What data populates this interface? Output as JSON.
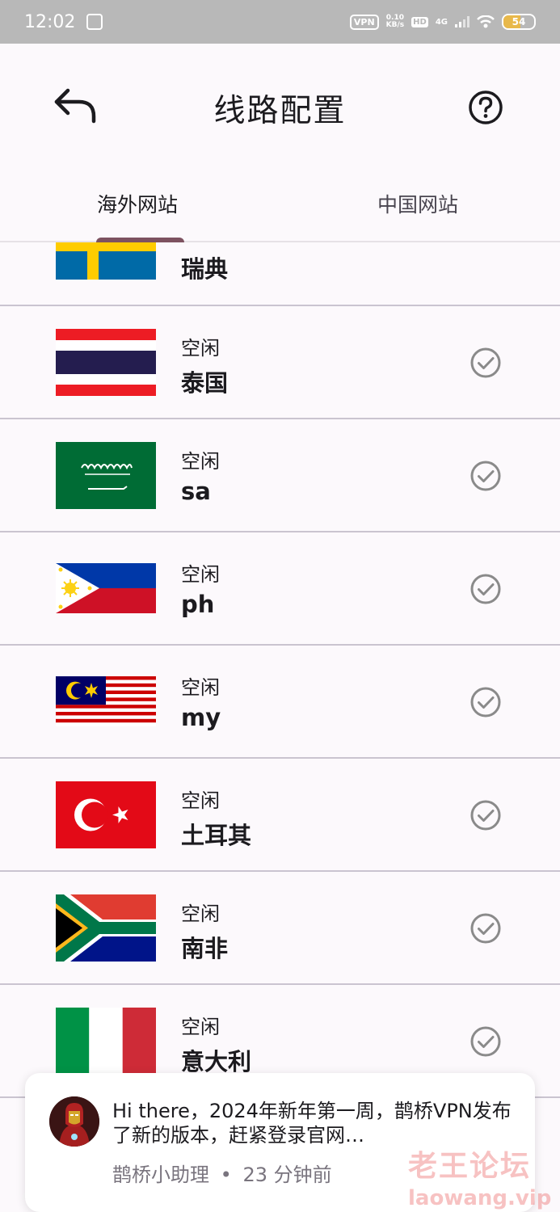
{
  "status_bar": {
    "time": "12:02",
    "vpn": "VPN",
    "speed_value": "0.10",
    "speed_unit": "KB/s",
    "hd": "HD",
    "network": "4G",
    "battery": "54",
    "battery_level": 0.54,
    "battery_color": "#e8b84a"
  },
  "header": {
    "title": "线路配置",
    "back_icon": "back-arrow-icon",
    "help_icon": "help-circle-icon"
  },
  "tabs": [
    {
      "label": "海外网站",
      "selected": true
    },
    {
      "label": "中国网站",
      "selected": false
    }
  ],
  "servers": [
    {
      "status": "",
      "name": "瑞典",
      "flag": "sweden"
    },
    {
      "status": "空闲",
      "name": "泰国",
      "flag": "thailand"
    },
    {
      "status": "空闲",
      "name": "sa",
      "flag": "saudi-arabia"
    },
    {
      "status": "空闲",
      "name": "ph",
      "flag": "philippines"
    },
    {
      "status": "空闲",
      "name": "my",
      "flag": "malaysia"
    },
    {
      "status": "空闲",
      "name": "土耳其",
      "flag": "turkey"
    },
    {
      "status": "空闲",
      "name": "南非",
      "flag": "south-africa"
    },
    {
      "status": "空闲",
      "name": "意大利",
      "flag": "italy"
    }
  ],
  "toast": {
    "message": "Hi there，2024年新年第一周，鹊桥VPN发布了新的版本，赶紧登录官网…",
    "sender": "鹊桥小助理",
    "separator": "•",
    "time": "23 分钟前"
  },
  "watermark": {
    "name": "老王论坛",
    "url": "laowang.vip"
  },
  "colors": {
    "accent": "#7d5260",
    "background": "#fcf9fc",
    "divider": "#cac4d0",
    "check": "#8a8a8a"
  }
}
